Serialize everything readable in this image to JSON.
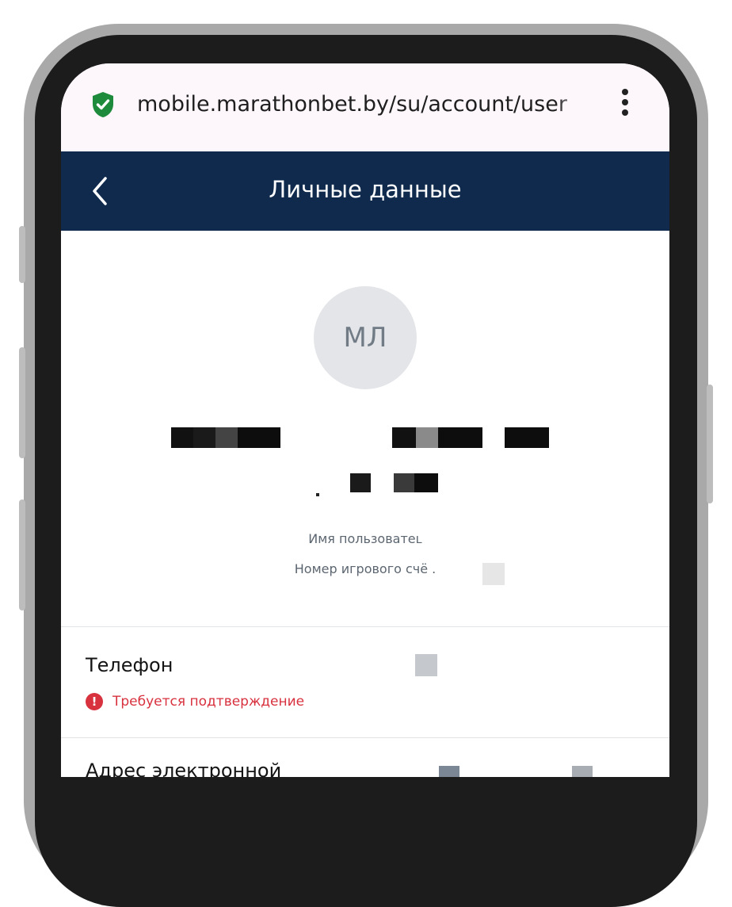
{
  "browser": {
    "url": "mobile.marathonbet.by/su/account/user",
    "secure_icon": "shield-check-icon",
    "menu_icon": "kebab-menu-icon"
  },
  "header": {
    "title": "Личные данные",
    "back_icon": "chevron-left-icon"
  },
  "profile": {
    "initials": "МЛ",
    "username_label": "Имя пользоватеʟ",
    "account_label": "Номер игрового счё ."
  },
  "fields": {
    "phone_title": "Телефон",
    "phone_warning": "Требуется подтверждение",
    "email_title": "Адрес электронной"
  },
  "colors": {
    "header_bg": "#0f2a4d",
    "urlbar_bg": "#fdf7fb",
    "warning": "#d8323f",
    "secure": "#1e8a3c"
  }
}
